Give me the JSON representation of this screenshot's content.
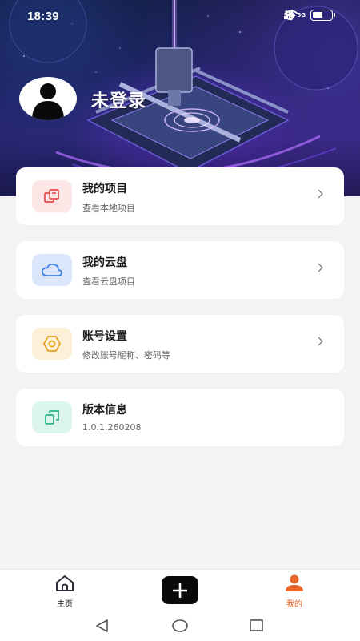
{
  "status_bar": {
    "time": "18:39",
    "signal_1_label": "5G",
    "signal_2_label": "5G",
    "battery_level": 0.55
  },
  "profile": {
    "username": "未登录"
  },
  "menu": [
    {
      "title": "我的项目",
      "subtitle": "查看本地项目",
      "icon": "folders-icon",
      "icon_bg": "#fde6e6",
      "icon_color": "#e24d4d",
      "has_chevron": true
    },
    {
      "title": "我的云盘",
      "subtitle": "查看云盘项目",
      "icon": "cloud-icon",
      "icon_bg": "#dbe6fb",
      "icon_color": "#3f82e0",
      "has_chevron": true
    },
    {
      "title": "账号设置",
      "subtitle": "修改账号昵称、密码等",
      "icon": "gear-icon",
      "icon_bg": "#fdf0d9",
      "icon_color": "#e5a321",
      "has_chevron": true
    },
    {
      "title": "版本信息",
      "subtitle": "1.0.1.260208",
      "icon": "copy-icon",
      "icon_bg": "#dcf5ee",
      "icon_color": "#2bb58a",
      "has_chevron": false
    }
  ],
  "bottom_nav": {
    "home_label": "主页",
    "mine_label": "我的",
    "active": "mine",
    "active_color": "#e8662a"
  }
}
